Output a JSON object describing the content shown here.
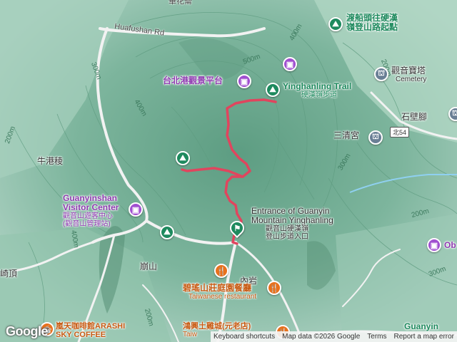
{
  "map": {
    "roads": {
      "huafushan": "Huafushan Rd",
      "north_top": "華花崙",
      "shield_54": "北54"
    },
    "places": {
      "taipei_port_deck": "台北港觀景平台",
      "yinghanling_trail_en": "Yinghanling Trail",
      "yinghanling_trail_zh": "硬漢嶺步道",
      "ferry_head": "渡船頭往硬漢",
      "ferry_head_line2": "嶺登山路起點",
      "guanyin_pagoda": "觀音寶塔",
      "cemetery": "Cemetery",
      "shibi": "石壁腳",
      "sanqing": "三清宮",
      "niugang": "牛港稜",
      "visitor_center_en1": "Guanyinshan",
      "visitor_center_en2": "Visitor Center",
      "visitor_center_zh1": "觀音山遊客中心",
      "visitor_center_zh2": "(觀音山管理站)",
      "entrance_en1": "Entrance of Guanyin",
      "entrance_en2": "Mountain Yinghanling",
      "entrance_zh1": "觀音山硬漢嶺",
      "entrance_zh2": "登山步道入口",
      "bengshan": "崩山",
      "neiyan": "內岩",
      "biling_restaurant_zh": "碧瑤山莊庭園餐廳",
      "biling_restaurant_en": "Taiwanese restaurant",
      "qiding": "崎頂",
      "arashi_zh": "嵐天咖啡館ARASHI",
      "arashi_en": "SKY COFFEE",
      "hongxing": "鴻興土雞城(元老店)",
      "taiwan_partial": "Taiw",
      "guanyin_bottom": "Guanyin",
      "obs_partial": "Ob"
    },
    "contours": {
      "c400a": "400m",
      "c500": "500m",
      "c400b": "400m",
      "c300": "300m",
      "c200a": "200m",
      "c400c": "400m",
      "c300b": "300m",
      "c200b": "200m",
      "c300c": "300m",
      "c200c": "200m",
      "c200d": "200m",
      "c300d": "300m"
    }
  },
  "footer": {
    "google": "Google",
    "keyboard": "Keyboard shortcuts",
    "map_data": "Map data ©2026 Google",
    "terms": "Terms",
    "report": "Report a map error"
  },
  "colors": {
    "route": "#e0455e",
    "terrain": "#7fb8a0",
    "road": "#e8e8e8"
  }
}
